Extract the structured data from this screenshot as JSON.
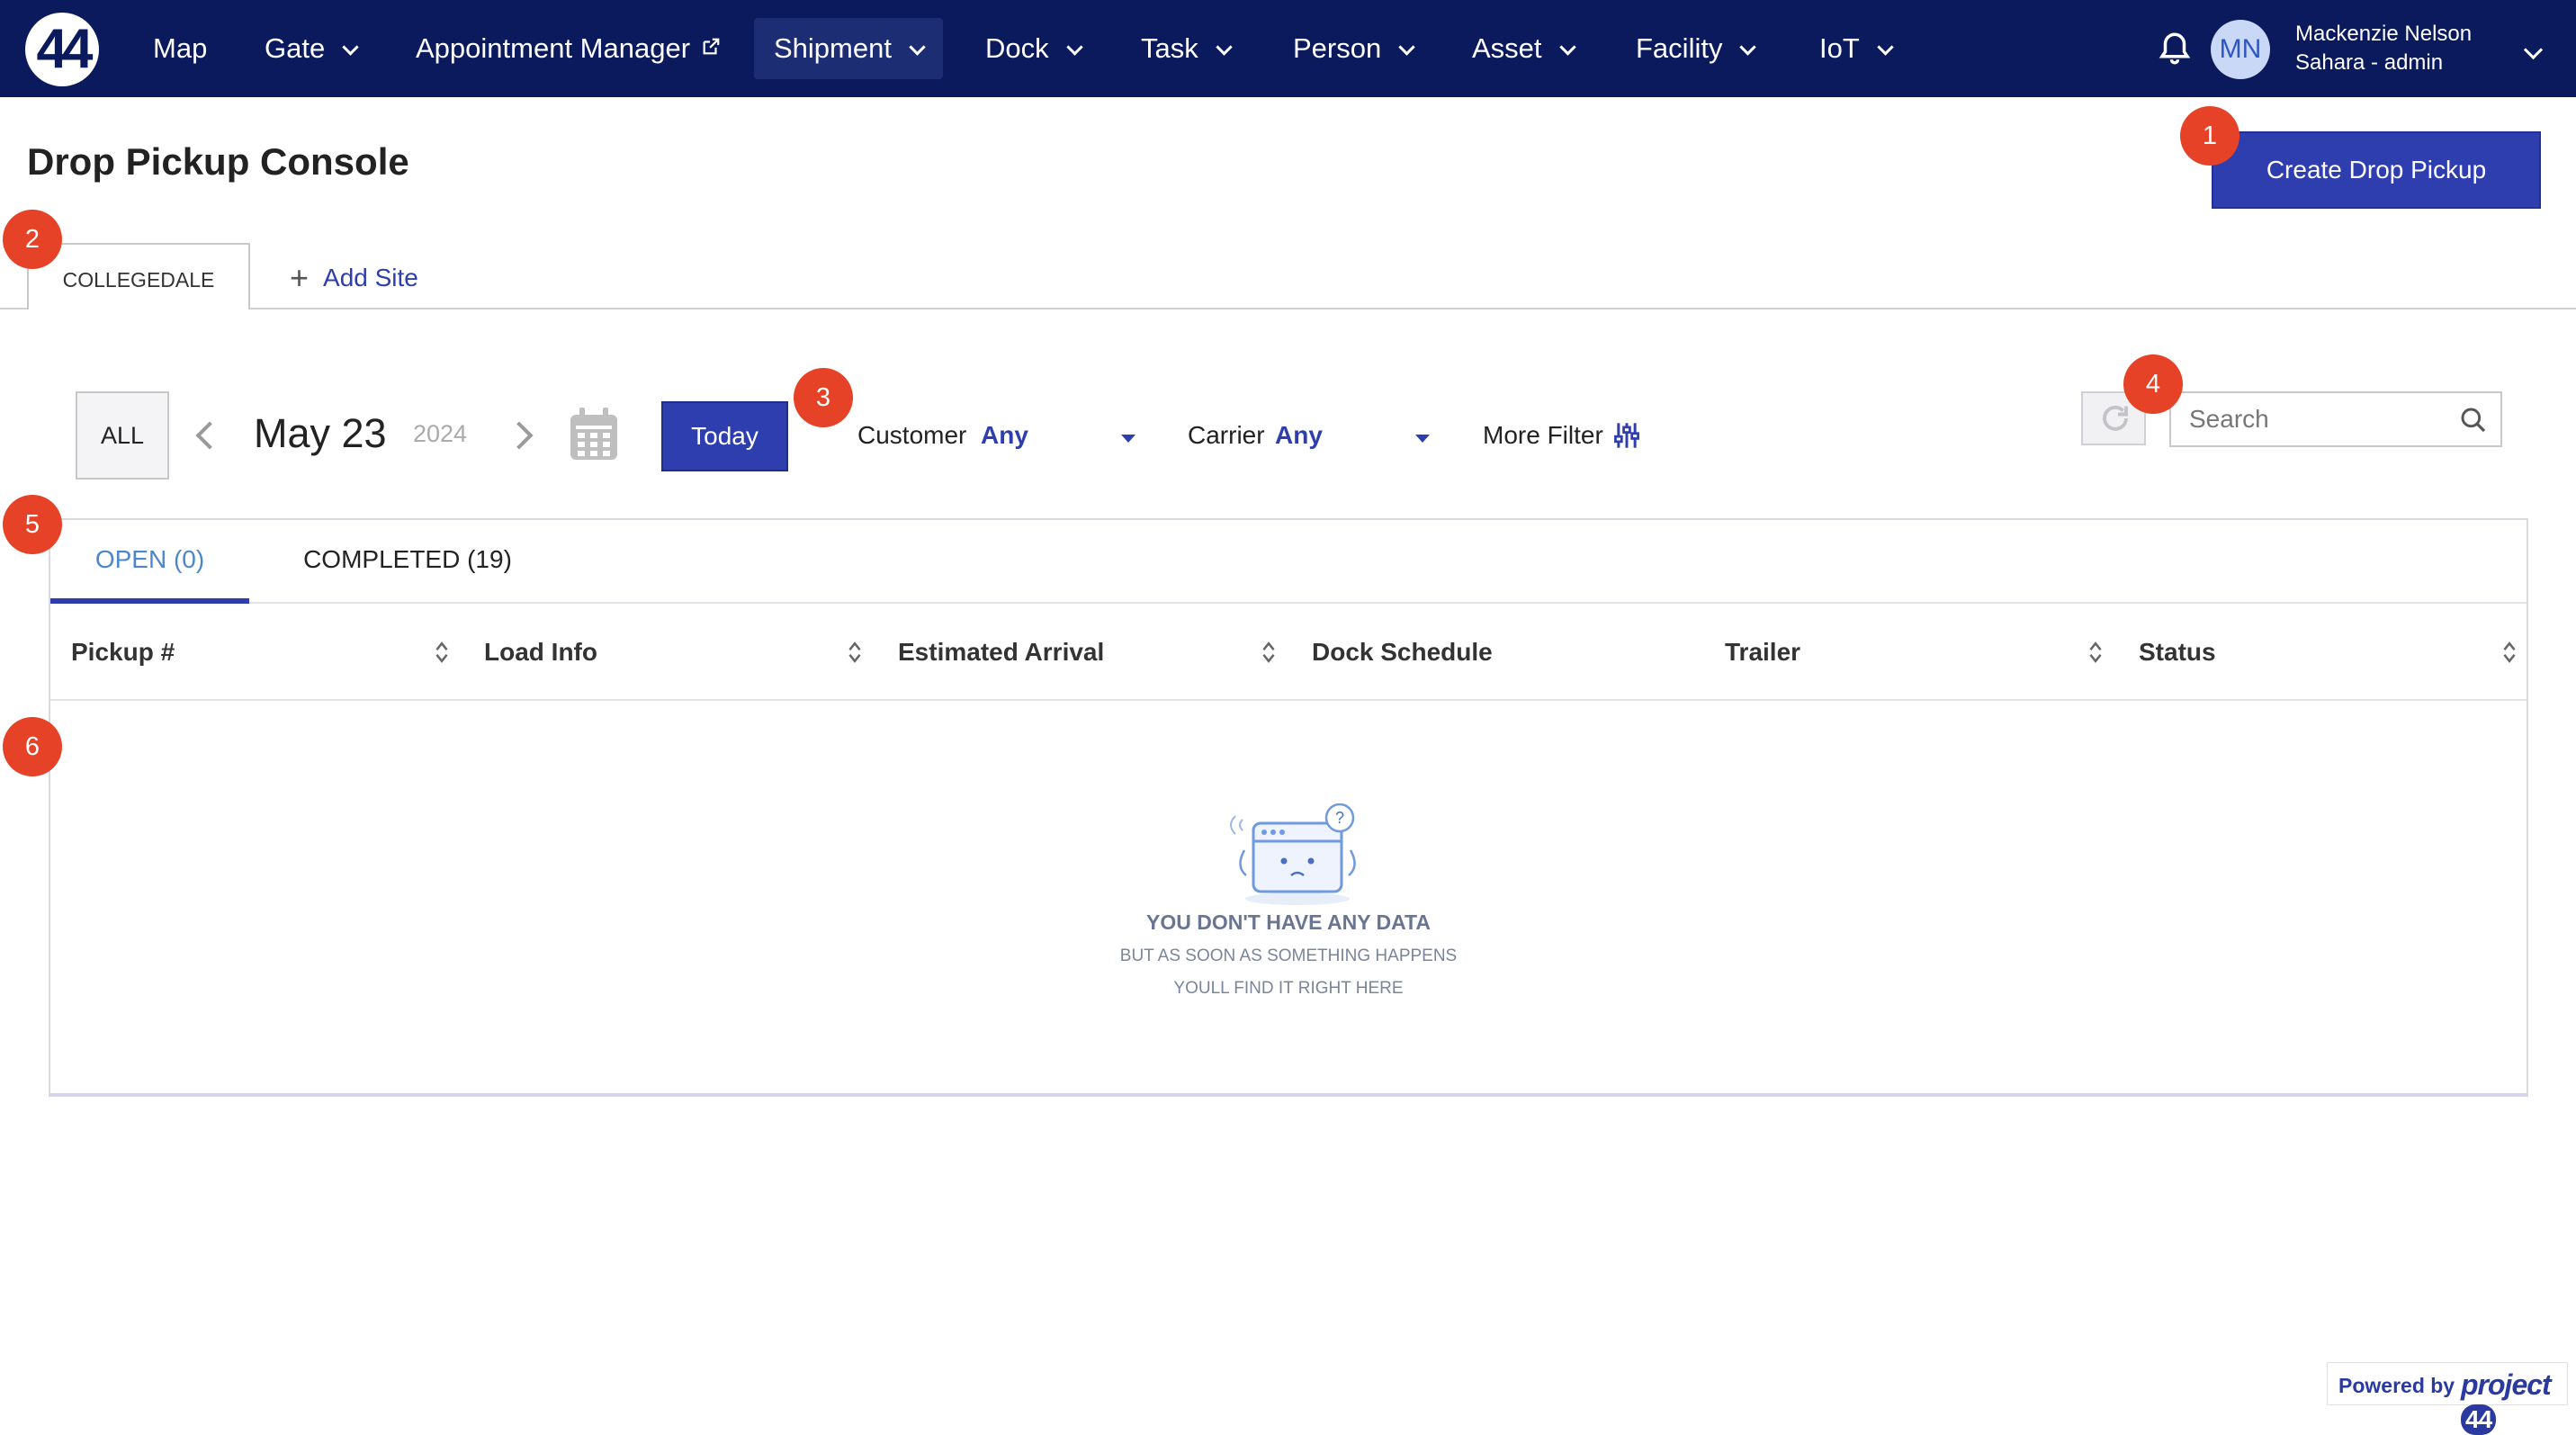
{
  "nav": {
    "logo_text": "44",
    "items": [
      {
        "label": "Map",
        "dropdown": false
      },
      {
        "label": "Gate",
        "dropdown": true
      },
      {
        "label": "Appointment Manager",
        "dropdown": false,
        "external": true
      },
      {
        "label": "Shipment",
        "dropdown": true,
        "active": true
      },
      {
        "label": "Dock",
        "dropdown": true
      },
      {
        "label": "Task",
        "dropdown": true
      },
      {
        "label": "Person",
        "dropdown": true
      },
      {
        "label": "Asset",
        "dropdown": true
      },
      {
        "label": "Facility",
        "dropdown": true
      },
      {
        "label": "IoT",
        "dropdown": true
      }
    ],
    "user": {
      "initials": "MN",
      "name": "Mackenzie Nelson",
      "role": "Sahara - admin"
    }
  },
  "page": {
    "title": "Drop Pickup Console",
    "create_button": "Create Drop Pickup"
  },
  "badges": [
    "1",
    "2",
    "3",
    "4",
    "5",
    "6"
  ],
  "sites": {
    "tabs": [
      "COLLEGEDALE"
    ],
    "add_label": "Add Site"
  },
  "toolbar": {
    "all_label": "ALL",
    "date": "May 23",
    "year": "2024",
    "today_label": "Today",
    "customer_label": "Customer",
    "customer_value": "Any",
    "carrier_label": "Carrier",
    "carrier_value": "Any",
    "more_filter_label": "More Filter",
    "search_placeholder": "Search"
  },
  "status_tabs": [
    {
      "label": "OPEN (0)",
      "active": true
    },
    {
      "label": "COMPLETED (19)",
      "active": false
    }
  ],
  "table": {
    "columns": [
      {
        "label": "Pickup #",
        "sortable": true
      },
      {
        "label": "Load Info",
        "sortable": true
      },
      {
        "label": "Estimated Arrival",
        "sortable": true
      },
      {
        "label": "Dock Schedule",
        "sortable": false
      },
      {
        "label": "Trailer",
        "sortable": true
      },
      {
        "label": "Status",
        "sortable": true
      }
    ],
    "rows": []
  },
  "empty_state": {
    "title": "YOU DON'T HAVE ANY DATA",
    "line1": "BUT AS SOON AS SOMETHING HAPPENS",
    "line2": "YOULL FIND IT RIGHT HERE"
  },
  "footer": {
    "powered_by": "Powered by",
    "brand": "project",
    "brand_badge": "44"
  },
  "colors": {
    "nav_bg": "#0a1a5c",
    "primary": "#2f3eaf",
    "badge": "#e64227",
    "active_tab_text": "#4d86cc"
  }
}
